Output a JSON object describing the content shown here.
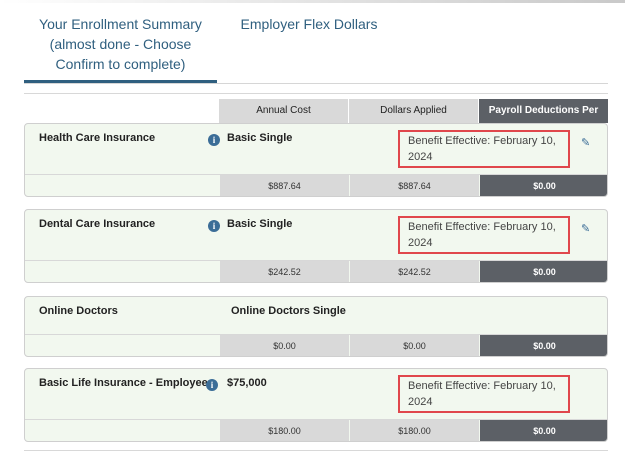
{
  "tabs": [
    {
      "label": "Your Enrollment Summary (almost done - Choose Confirm to complete)"
    },
    {
      "label": "Employer Flex Dollars"
    }
  ],
  "columns": {
    "annual_cost": "Annual Cost",
    "dollars_applied": "Dollars Applied",
    "payroll": "Payroll Deductions Per Pay"
  },
  "benefits": [
    {
      "name": "Health Care Insurance",
      "plan": "Basic Single",
      "effective": "Benefit Effective: February 10, 2024",
      "annual_cost": "$887.64",
      "dollars_applied": "$887.64",
      "payroll": "$0.00"
    },
    {
      "name": "Dental Care Insurance",
      "plan": "Basic Single",
      "effective": "Benefit Effective: February 10, 2024",
      "annual_cost": "$242.52",
      "dollars_applied": "$242.52",
      "payroll": "$0.00"
    },
    {
      "name": "Online Doctors",
      "plan": "Online Doctors Single",
      "annual_cost": "$0.00",
      "dollars_applied": "$0.00",
      "payroll": "$0.00"
    },
    {
      "name": "Basic Life Insurance - Employee",
      "plan": "$75,000",
      "effective": "Benefit Effective: February 10, 2024",
      "annual_cost": "$180.00",
      "dollars_applied": "$180.00",
      "payroll": "$0.00"
    }
  ],
  "icons": {
    "info": "info-icon",
    "edit": "pencil-icon"
  },
  "colors": {
    "accent": "#2f5f7f",
    "highlight_border": "#e0474c",
    "card_bg": "#f2f8ef",
    "dark_cell": "#5c6066"
  }
}
